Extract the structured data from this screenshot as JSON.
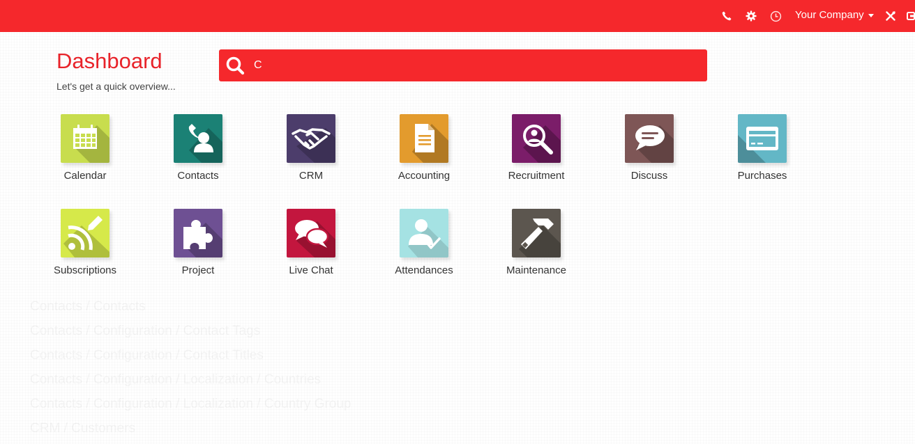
{
  "topbar": {
    "company_label": "Your Company",
    "icons": [
      "phone-icon",
      "gear-icon",
      "clock-icon",
      "tools-icon",
      "logout-icon"
    ]
  },
  "dashboard": {
    "title": "Dashboard",
    "subtitle": "Let's get a quick overview..."
  },
  "search": {
    "value": "C"
  },
  "apps": [
    {
      "label": "Calendar",
      "icon": "calendar-icon",
      "color": "#c2d94d"
    },
    {
      "label": "Contacts",
      "icon": "contacts-icon",
      "color": "#1b8175"
    },
    {
      "label": "CRM",
      "icon": "handshake-icon",
      "color": "#4b3b66"
    },
    {
      "label": "Accounting",
      "icon": "document-icon",
      "color": "#e09a2e"
    },
    {
      "label": "Recruitment",
      "icon": "magnifier-person-icon",
      "color": "#7a1c67"
    },
    {
      "label": "Discuss",
      "icon": "chat-bubble-icon",
      "color": "#7e5555"
    },
    {
      "label": "Purchases",
      "icon": "credit-card-icon",
      "color": "#5fb6c5"
    },
    {
      "label": "Subscriptions",
      "icon": "rss-icon",
      "color": "#d3e847"
    },
    {
      "label": "Project",
      "icon": "puzzle-icon",
      "color": "#6e4f91"
    },
    {
      "label": "Live Chat",
      "icon": "chat-bubbles-icon",
      "color": "#c2163d"
    },
    {
      "label": "Attendances",
      "icon": "user-check-icon",
      "color": "#8fd4d6"
    },
    {
      "label": "Maintenance",
      "icon": "hammer-icon",
      "color": "#5b554e"
    }
  ],
  "menu_results": [
    "Contacts / Contacts",
    "Contacts / Configuration / Contact Tags",
    "Contacts / Configuration / Contact Titles",
    "Contacts / Configuration / Localization / Countries",
    "Contacts / Configuration / Localization / Country Group",
    "CRM / Customers"
  ]
}
